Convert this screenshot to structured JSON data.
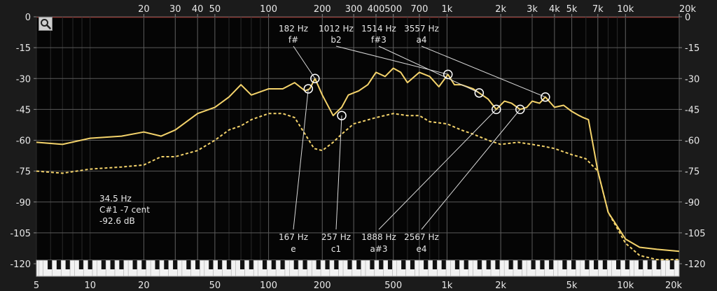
{
  "chart_data": {
    "type": "line",
    "title": "",
    "xlabel": "",
    "ylabel": "",
    "x_scale": "log",
    "xlim": [
      5,
      20000
    ],
    "ylim": [
      -120,
      0
    ],
    "grid": true,
    "top_ticks": [
      20,
      30,
      40,
      50,
      100,
      200,
      300,
      400,
      500,
      700,
      "1k",
      "2k",
      "3k",
      "4k",
      "5k",
      "7k",
      "10k",
      "20k"
    ],
    "top_ticks_hz": [
      20,
      30,
      40,
      50,
      100,
      200,
      300,
      400,
      500,
      700,
      1000,
      2000,
      3000,
      4000,
      5000,
      7000,
      10000,
      20000
    ],
    "bottom_ticks": [
      5,
      10,
      20,
      50,
      100,
      200,
      500,
      "1k",
      "2k",
      "5k",
      "10k",
      "20k"
    ],
    "bottom_ticks_hz": [
      5,
      10,
      20,
      50,
      100,
      200,
      500,
      1000,
      2000,
      5000,
      10000,
      20000
    ],
    "y_ticks": [
      0,
      -15,
      -30,
      -45,
      -60,
      -75,
      -90,
      -105,
      -120
    ],
    "series": [
      {
        "style": "solid",
        "color": "#f4d36b",
        "x": [
          5,
          7,
          10,
          15,
          20,
          25,
          30,
          40,
          50,
          60,
          70,
          80,
          100,
          120,
          140,
          160,
          170,
          182,
          200,
          230,
          257,
          280,
          320,
          360,
          400,
          450,
          500,
          550,
          600,
          700,
          800,
          900,
          1012,
          1100,
          1200,
          1400,
          1514,
          1700,
          1888,
          2100,
          2300,
          2567,
          2800,
          3000,
          3300,
          3557,
          4000,
          4500,
          5000,
          5500,
          5800,
          6200,
          7000,
          8000,
          10000,
          12000,
          15000,
          20000
        ],
        "y": [
          -61,
          -62,
          -59,
          -58,
          -56,
          -58,
          -55,
          -47,
          -44,
          -39,
          -33,
          -38,
          -35,
          -35,
          -32,
          -36,
          -35,
          -30,
          -38,
          -48,
          -44,
          -38,
          -36,
          -33,
          -27,
          -29,
          -25,
          -27,
          -32,
          -27,
          -29,
          -34,
          -28,
          -33,
          -33,
          -35,
          -37,
          -40,
          -45,
          -41,
          -42,
          -45,
          -44,
          -41,
          -42,
          -39,
          -44,
          -43,
          -46,
          -48,
          -49,
          -50,
          -75,
          -95,
          -108,
          -112,
          -113,
          -114
        ]
      },
      {
        "style": "dashed",
        "color": "#f4d36b",
        "x": [
          5,
          7,
          10,
          15,
          20,
          25,
          30,
          40,
          50,
          60,
          70,
          80,
          100,
          120,
          140,
          160,
          180,
          200,
          230,
          257,
          300,
          400,
          500,
          600,
          700,
          800,
          1000,
          1200,
          1400,
          1700,
          2000,
          2500,
          3000,
          3500,
          4000,
          5000,
          5500,
          6000,
          7000,
          8000,
          10000,
          12000,
          15000,
          20000
        ],
        "y": [
          -75,
          -76,
          -74,
          -73,
          -72,
          -68,
          -68,
          -65,
          -60,
          -55,
          -53,
          -50,
          -47,
          -47,
          -49,
          -57,
          -64,
          -65,
          -61,
          -57,
          -52,
          -49,
          -47,
          -48,
          -48,
          -51,
          -52,
          -55,
          -57,
          -60,
          -62,
          -61,
          -62,
          -63,
          -64,
          -67,
          -68,
          -69,
          -75,
          -95,
          -110,
          -116,
          -118,
          -118
        ]
      }
    ],
    "peaks": [
      {
        "freq": 167,
        "label_hz": "167 Hz",
        "note": "e",
        "db": -35,
        "label_pos": "bottom"
      },
      {
        "freq": 182,
        "label_hz": "182 Hz",
        "note": "f#",
        "db": -30,
        "label_pos": "top"
      },
      {
        "freq": 257,
        "label_hz": "257 Hz",
        "note": "c1",
        "db": -48,
        "label_pos": "bottom"
      },
      {
        "freq": 1012,
        "label_hz": "1012 Hz",
        "note": "b2",
        "db": -28,
        "label_pos": "top"
      },
      {
        "freq": 1514,
        "label_hz": "1514 Hz",
        "note": "f#3",
        "db": -37,
        "label_pos": "top"
      },
      {
        "freq": 1888,
        "label_hz": "1888 Hz",
        "note": "a#3",
        "db": -45,
        "label_pos": "bottom"
      },
      {
        "freq": 2567,
        "label_hz": "2567 Hz",
        "note": "e4",
        "db": -45,
        "label_pos": "bottom"
      },
      {
        "freq": 3557,
        "label_hz": "3557 Hz",
        "note": "a4",
        "db": -39,
        "label_pos": "top"
      }
    ],
    "cursor_readout": [
      "34.5 Hz",
      "C#1 -7 cent",
      "-92.6 dB"
    ]
  }
}
